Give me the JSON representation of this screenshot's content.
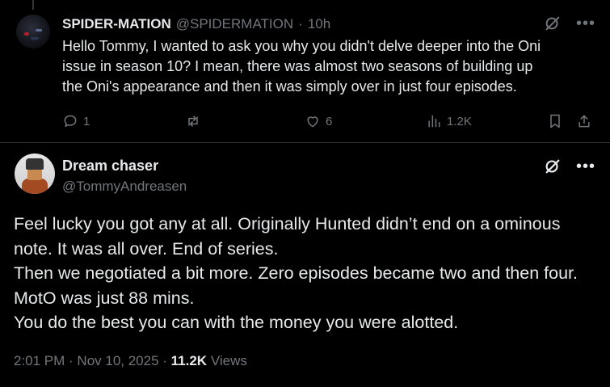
{
  "parent_tweet": {
    "display_name": "SPIDER-MATION",
    "handle": "@SPIDERMATION",
    "separator": "·",
    "time": "10h",
    "text_lines": [
      "Hello Tommy, I wanted to ask you why you didn't delve deeper into the Oni",
      "issue in season 10? I mean, there was almost two seasons of building up",
      "the Oni's appearance and then it was simply over in just four episodes."
    ],
    "replies": "1",
    "reposts": "",
    "likes": "6",
    "views": "1.2K"
  },
  "main_tweet": {
    "display_name": "Dream chaser",
    "handle": "@TommyAndreasen",
    "body_lines": [
      "Feel lucky you got any at all. Originally Hunted didn’t end on a ominous",
      "note. It was all over. End of series.",
      "Then we negotiated a bit more. Zero episodes became two and then four.",
      "MotO was just 88 mins.",
      "You do the best you can with the money you were alotted."
    ],
    "timestamp": "2:01 PM · Nov 10, 2025 · ",
    "views_count": "11.2K",
    "views_label": " Views"
  },
  "icons": {
    "grok": "grok-icon",
    "more": "more-icon",
    "reply": "reply-icon",
    "repost": "repost-icon",
    "like": "heart-icon",
    "views": "views-icon",
    "bookmark": "bookmark-icon",
    "share": "share-icon"
  },
  "colors": {
    "background": "#000000",
    "text": "#e7e9ea",
    "muted": "#71767b",
    "divider": "#2f3336"
  }
}
